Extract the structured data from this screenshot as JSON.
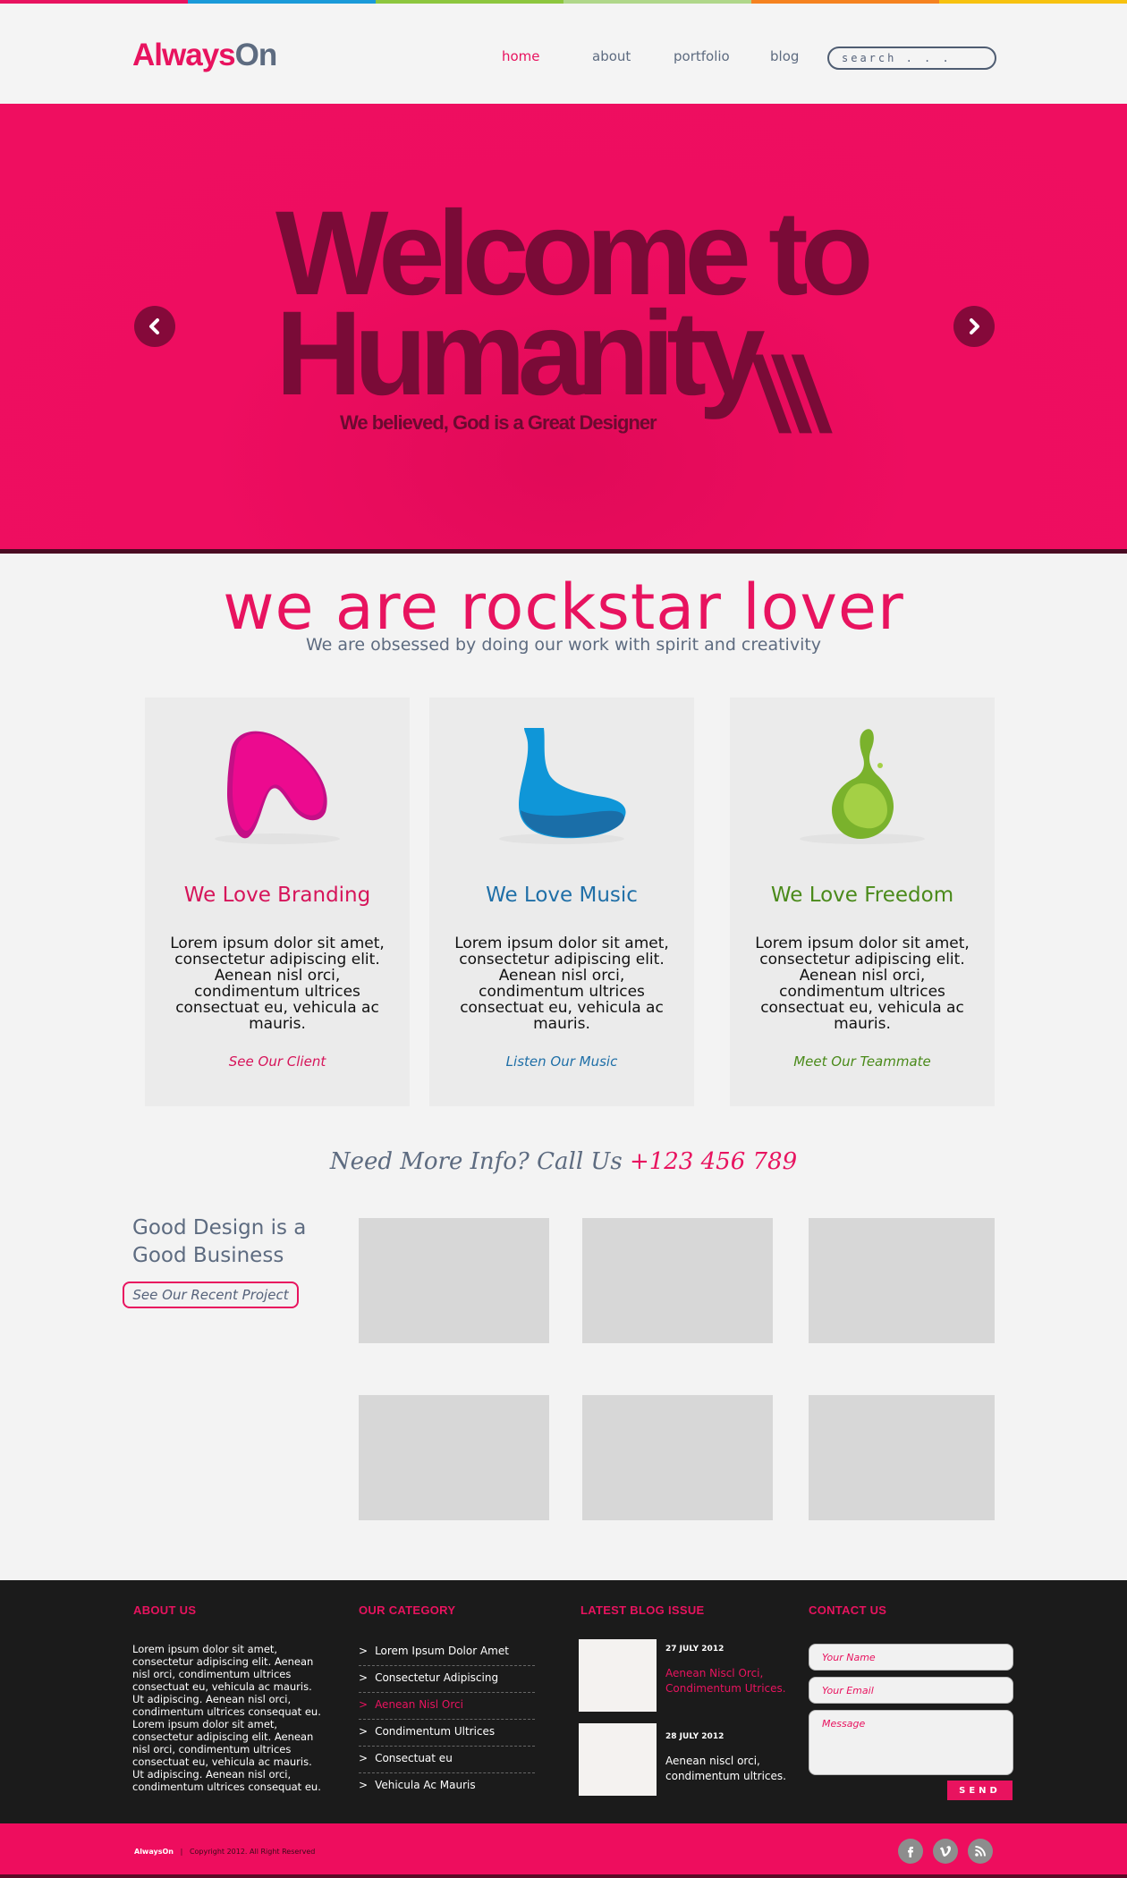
{
  "brand": {
    "part1": "Always",
    "part2": "On",
    "pink": "#e8135f",
    "slate": "#5d6b80"
  },
  "stripe_colors": [
    "#e8135f",
    "#1a9ad9",
    "#8dc63f",
    "#b0d78a",
    "#f58220",
    "#f7c20f"
  ],
  "nav": {
    "items": [
      "home",
      "about",
      "portfolio",
      "blog"
    ],
    "active": "home",
    "search_placeholder": "search . . ."
  },
  "hero": {
    "title_line1": "Welcome to",
    "title_line2": "Humanity",
    "slashes": "\\\\\\",
    "subtitle": "We believed, God is a Great Designer",
    "prev_icon": "chevron-left-icon",
    "next_icon": "chevron-right-icon"
  },
  "tagline": {
    "title": "we are rockstar lover",
    "subtitle": "We are obsessed by doing our work with spirit and creativity"
  },
  "features": [
    {
      "title": "We Love Branding",
      "text": "Lorem ipsum dolor sit amet, consectetur adipiscing elit. Aenean nisl orci, condimentum ultrices consectuat eu, vehicula ac mauris.",
      "link": "See Our Client",
      "color": "#d6145a",
      "icon": "pink-blob-icon"
    },
    {
      "title": "We Love Music",
      "text": "Lorem ipsum dolor sit amet, consectetur adipiscing elit. Aenean nisl orci, condimentum ultrices consectuat eu, vehicula ac mauris.",
      "link": "Listen Our Music",
      "color": "#1f6fa7",
      "icon": "blue-blob-icon"
    },
    {
      "title": "We Love Freedom",
      "text": "Lorem ipsum dolor sit amet, consectetur adipiscing elit. Aenean nisl orci, condimentum ultrices consectuat eu, vehicula ac mauris.",
      "link": "Meet Our Teammate",
      "color": "#4a8a1a",
      "icon": "green-drop-icon"
    }
  ],
  "call": {
    "text": "Need More Info? Call Us ",
    "phone": "+123 456 789"
  },
  "portfolio": {
    "title": "Good Design is a Good Business",
    "button": "See Our Recent Project"
  },
  "footer": {
    "about_heading": "ABOUT US",
    "about_text": "Lorem ipsum dolor sit amet, consectetur adipiscing elit. Aenean nisl orci, condimentum ultrices consectuat eu, vehicula ac mauris. Ut adipiscing. Aenean nisl orci, condimentum ultrices consequat eu. Lorem ipsum dolor sit amet, consectetur adipiscing elit. Aenean nisl orci, condimentum ultrices consectuat eu, vehicula ac mauris. Ut adipiscing. Aenean nisl orci, condimentum ultrices consequat eu.",
    "category_heading": "OUR CATEGORY",
    "categories": [
      "Lorem Ipsum Dolor Amet",
      "Consectetur Adipiscing",
      "Aenean Nisl Orci",
      "Condimentum Ultrices",
      "Consectuat eu",
      "Vehicula Ac Mauris"
    ],
    "active_category": "Aenean Nisl Orci",
    "blog_heading": "LATEST BLOG ISSUE",
    "blog": [
      {
        "date": "27 JULY 2012",
        "text": "Aenean Niscl Orci, Condimentum Utrices.",
        "highlight": true
      },
      {
        "date": "28 JULY 2012",
        "text": "Aenean niscl orci, condimentum ultrices.",
        "highlight": false
      }
    ],
    "contact_heading": "CONTACT US",
    "name_placeholder": "Your Name",
    "email_placeholder": "Your Email",
    "message_placeholder": "Message",
    "send_label": "SEND"
  },
  "bottom": {
    "brand": "AlwaysOn",
    "separator": "|",
    "copyright": "Copyright 2012. All Right Reserved",
    "social": [
      "facebook-icon",
      "vimeo-icon",
      "rss-icon"
    ]
  }
}
